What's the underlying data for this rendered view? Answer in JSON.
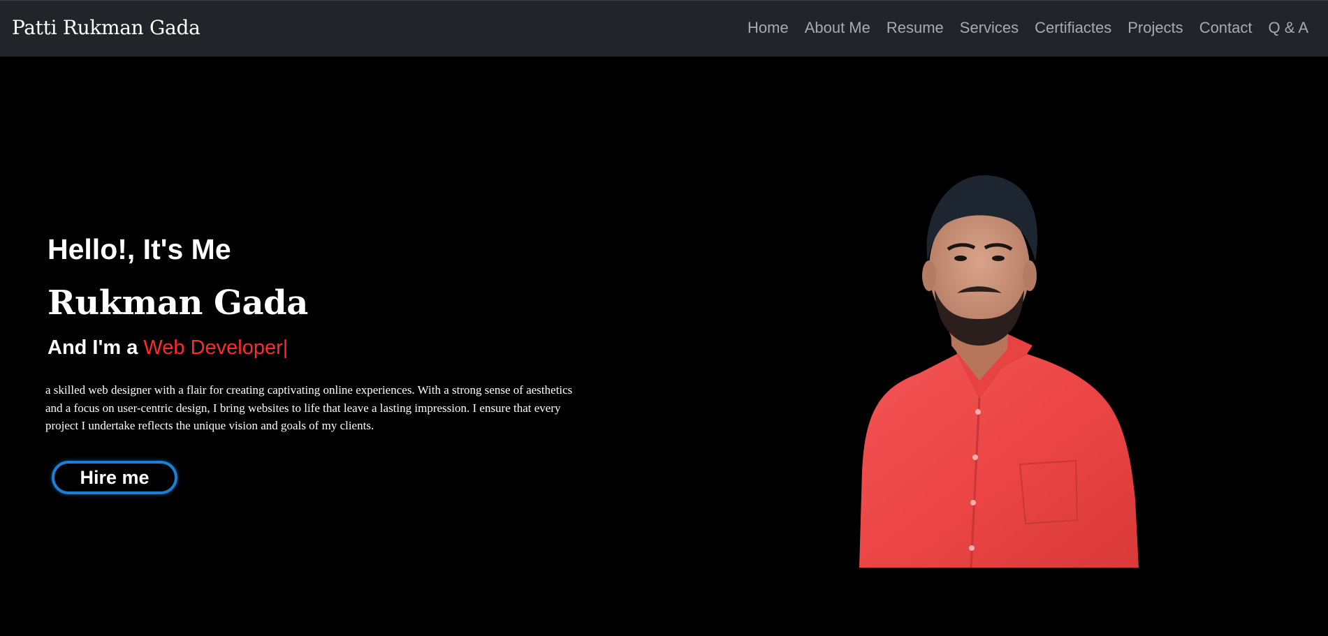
{
  "navbar": {
    "brand": "Patti Rukman Gada",
    "links": [
      "Home",
      "About Me",
      "Resume",
      "Services",
      "Certifiactes",
      "Projects",
      "Contact",
      "Q & A"
    ]
  },
  "hero": {
    "greeting": "Hello!, It's Me",
    "name": "Rukman Gada",
    "role_prefix": "And I'm a ",
    "role_highlight": "Web Developer|",
    "description": "a skilled web designer with a flair for creating captivating online experiences. With a strong sense of aesthetics and a focus on user-centric design, I bring websites to life that leave a lasting impression. I ensure that every project I undertake reflects the unique vision and goals of my clients.",
    "hire_button": "Hire me"
  },
  "colors": {
    "navbar_bg": "#212529",
    "page_bg": "#000000",
    "nav_link": "#a7abb0",
    "accent_red": "#ff2a2a",
    "button_border": "#1a7fd6",
    "shirt": "#f04a4a"
  },
  "portrait": {
    "icon": "person-portrait-photo"
  }
}
